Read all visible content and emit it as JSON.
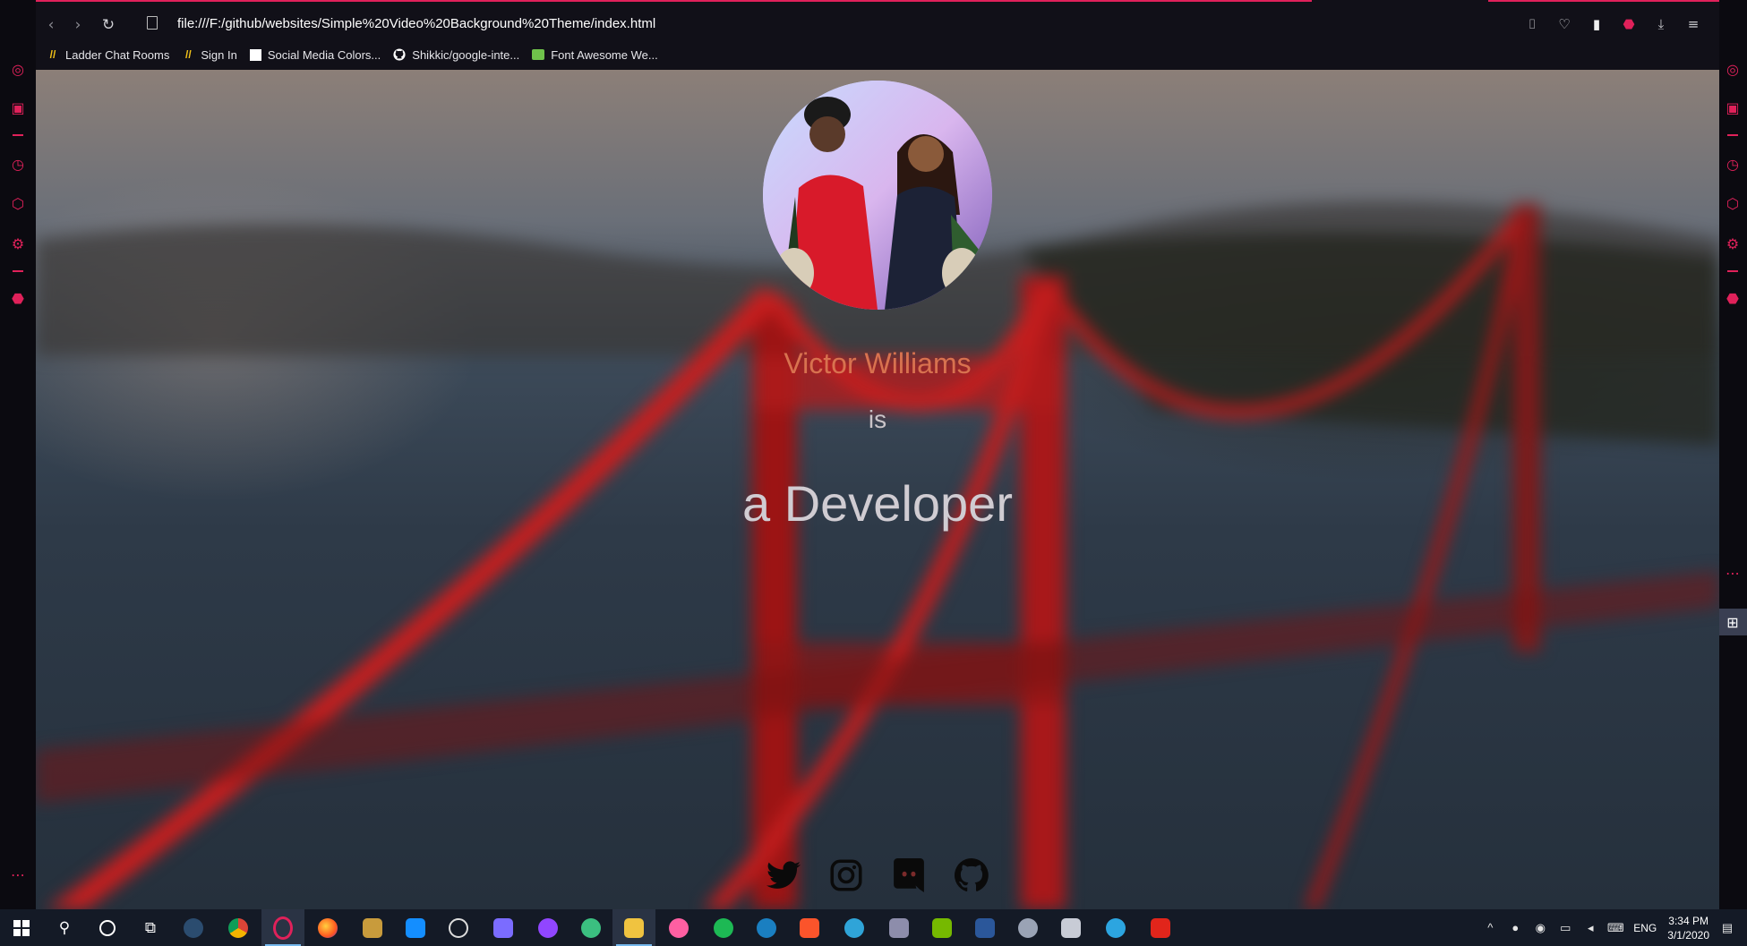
{
  "browser": {
    "url": "file:///F:/github/websites/Simple%20Video%20Background%20Theme/index.html",
    "bookmarks": [
      {
        "label": "Ladder Chat Rooms",
        "icon": "ladder-icon"
      },
      {
        "label": "Sign In",
        "icon": "ladder-icon"
      },
      {
        "label": "Social Media Colors...",
        "icon": "page-icon"
      },
      {
        "label": "Shikkic/google-inte...",
        "icon": "github-icon"
      },
      {
        "label": "Font Awesome We...",
        "icon": "font-awesome-icon"
      }
    ],
    "accent_color": "#e0215a"
  },
  "page": {
    "name": "Victor Williams",
    "connector": "is",
    "role": "a Developer",
    "name_color": "#d8724f",
    "socials": [
      "twitter-icon",
      "instagram-icon",
      "discord-icon",
      "github-icon"
    ]
  },
  "taskbar": {
    "language": "ENG",
    "time": "3:34 PM",
    "date": "3/1/2020"
  }
}
